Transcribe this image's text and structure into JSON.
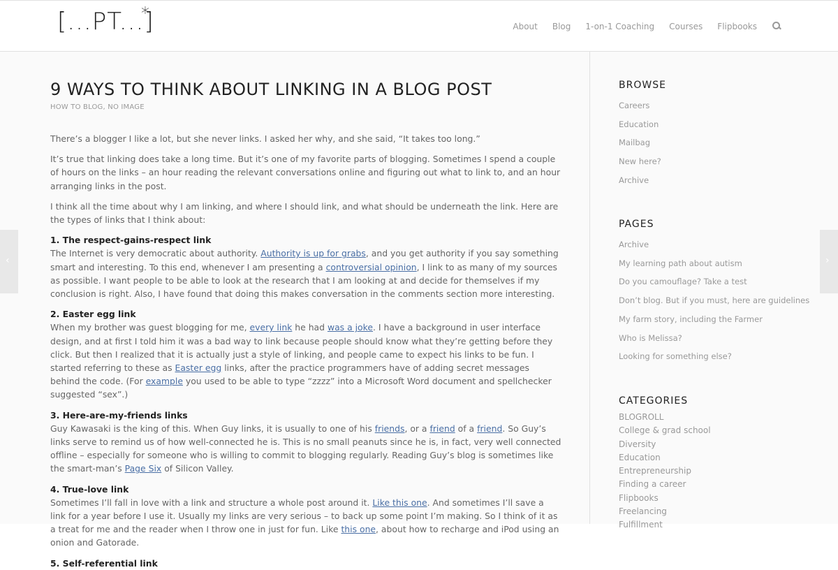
{
  "header": {
    "logo": "[...PT...]",
    "logo_star": "*",
    "nav": [
      "About",
      "Blog",
      "1-on-1 Coaching",
      "Courses",
      "Flipbooks"
    ],
    "search_icon": "search-icon"
  },
  "post": {
    "title": "9 WAYS TO THINK ABOUT LINKING IN A BLOG POST",
    "meta": "HOW TO BLOG, NO IMAGE",
    "p1": "There’s a blogger I like a lot, but she never links. I asked her why, and she said, “It takes too long.”",
    "p2": "It’s true that linking does take a long time. But it’s one of my favorite parts of blogging. Sometimes I spend a couple of hours on the links – an hour reading the relevant conversations online and figuring out what to link to, and an hour arranging links in the post.",
    "p3": "I think all the time about why I am linking, and where I should link, and what should be underneath the link. Here are the types of links that I think about:",
    "h1": "1. The respect-gains-respect link",
    "s1": {
      "a": "The Internet is very democratic about authority. ",
      "l1": "Authority is up for grabs",
      "b": ", and you get authority if you say something smart and interesting. To this end, whenever I am presenting a ",
      "l2": "controversial opinion",
      "c": ", I link to as many of my sources as possible. I want people to be able to look at the research that I am looking at and decide for themselves if my conclusion is right. Also, I have found that doing this makes conversation in the comments section more interesting."
    },
    "h2": "2. Easter egg link",
    "s2": {
      "a": "When my brother was guest blogging for me, ",
      "l1": "every link",
      "b": " he had ",
      "l2": "was a joke",
      "c": ". I have a background in user interface design, and at first I told him it was a bad way to link because people should know what they’re getting before they click. But then I realized that it is actually just a style of linking, and people came to expect his links to be fun. I started referring to these as ",
      "l3": "Easter egg",
      "d": " links, after the practice programmers have of adding secret messages behind the code. (For ",
      "l4": "example",
      "e": " you used to be able to type “zzzz” into a Microsoft Word document and spellchecker suggested “sex”.)"
    },
    "h3": "3. Here-are-my-friends links",
    "s3": {
      "a": "Guy Kawasaki is the king of this. When Guy links, it is usually to one of his ",
      "l1": "friends",
      "b": ", or a ",
      "l2": "friend",
      "c": " of a ",
      "l3": "friend",
      "d": ". So Guy’s links serve to remind us of how well-connected he is. This is no small peanuts since he is, in fact, very well connected offline – especially for someone who is willing to commit to blogging regularly. Reading Guy’s blog is sometimes like the smart-man’s ",
      "l4": "Page Six",
      "e": " of Silicon Valley."
    },
    "h4": "4. True-love link",
    "s4": {
      "a": "Sometimes I’ll fall in love with a link and structure a whole post around it. ",
      "l1": "Like this one",
      "b": ". And sometimes I’ll save a link for a year before I use it. Usually my links are very serious – to back up some point I’m making. So I think of it as a treat for me and the reader when I throw one in just for fun. Like ",
      "l2": "this one",
      "c": ", about how to recharge and iPod using an onion and Gatorade."
    },
    "h5": "5. Self-referential link"
  },
  "sidebar": {
    "browse_title": "BROWSE",
    "browse": [
      "Careers",
      "Education",
      "Mailbag",
      "New here?",
      "Archive"
    ],
    "pages_title": "PAGES",
    "pages": [
      "Archive",
      "My learning path about autism",
      "Do you camouflage? Take a test",
      "Don’t blog. But if you must, here are guidelines",
      "My farm story, including the Farmer",
      "Who is Melissa?",
      "Looking for something else?"
    ],
    "categories_title": "CATEGORIES",
    "categories": [
      "BLOGROLL",
      "College & grad school",
      "Diversity",
      "Education",
      "Entrepreneurship",
      "Finding a career",
      "Flipbooks",
      "Freelancing",
      "Fulfillment"
    ]
  },
  "arrows": {
    "left": "‹",
    "right": "›"
  }
}
